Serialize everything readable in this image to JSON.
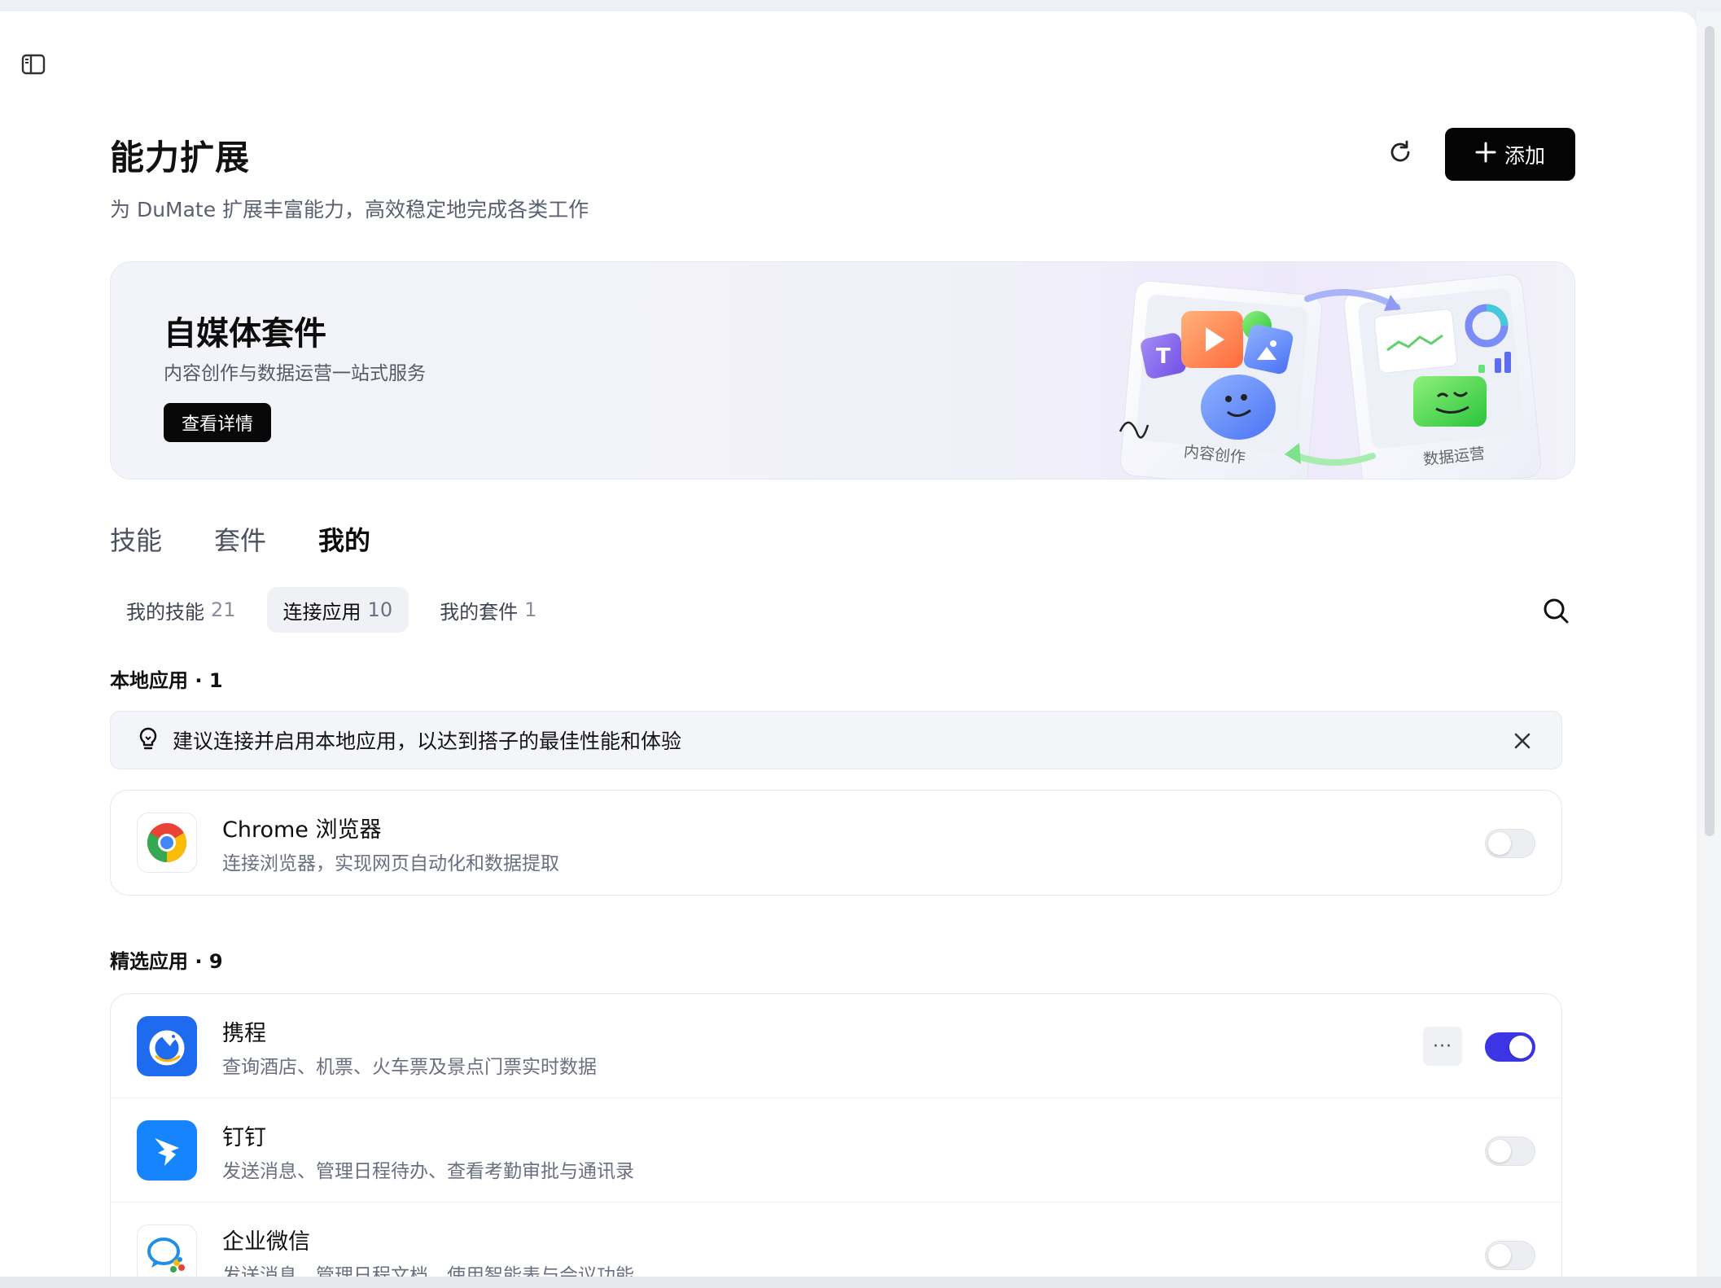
{
  "header": {
    "title": "能力扩展",
    "subtitle": "为 DuMate 扩展丰富能力，高效稳定地完成各类工作",
    "add_label": "添加"
  },
  "banner": {
    "title": "自媒体套件",
    "subtitle": "内容创作与数据运营一站式服务",
    "button_label": "查看详情",
    "art_labels": [
      "内容创作",
      "数据运营"
    ]
  },
  "main_tabs": [
    {
      "label": "技能",
      "active": false
    },
    {
      "label": "套件",
      "active": false
    },
    {
      "label": "我的",
      "active": true
    }
  ],
  "sub_tabs": [
    {
      "label": "我的技能",
      "count": "21",
      "active": false
    },
    {
      "label": "连接应用",
      "count": "10",
      "active": true
    },
    {
      "label": "我的套件",
      "count": "1",
      "active": false
    }
  ],
  "local_section": {
    "title": "本地应用 · 1",
    "tip": "建议连接并启用本地应用，以达到搭子的最佳性能和体验",
    "apps": [
      {
        "name": "Chrome 浏览器",
        "desc": "连接浏览器，实现网页自动化和数据提取",
        "icon": "chrome-icon",
        "enabled": false
      }
    ]
  },
  "featured_section": {
    "title": "精选应用 · 9",
    "apps": [
      {
        "name": "携程",
        "desc": "查询酒店、机票、火车票及景点门票实时数据",
        "icon": "ctrip-icon",
        "enabled": true,
        "more": "···"
      },
      {
        "name": "钉钉",
        "desc": "发送消息、管理日程待办、查看考勤审批与通讯录",
        "icon": "dingtalk-icon",
        "enabled": false
      },
      {
        "name": "企业微信",
        "desc": "发送消息、管理日程文档、使用智能表与会议功能",
        "icon": "wecom-icon",
        "enabled": false
      }
    ]
  },
  "colors": {
    "accent": "#3b35e6",
    "primary_button": "#050505",
    "ctrip_blue": "#1f6bf0",
    "dingtalk_blue": "#1684fc"
  }
}
